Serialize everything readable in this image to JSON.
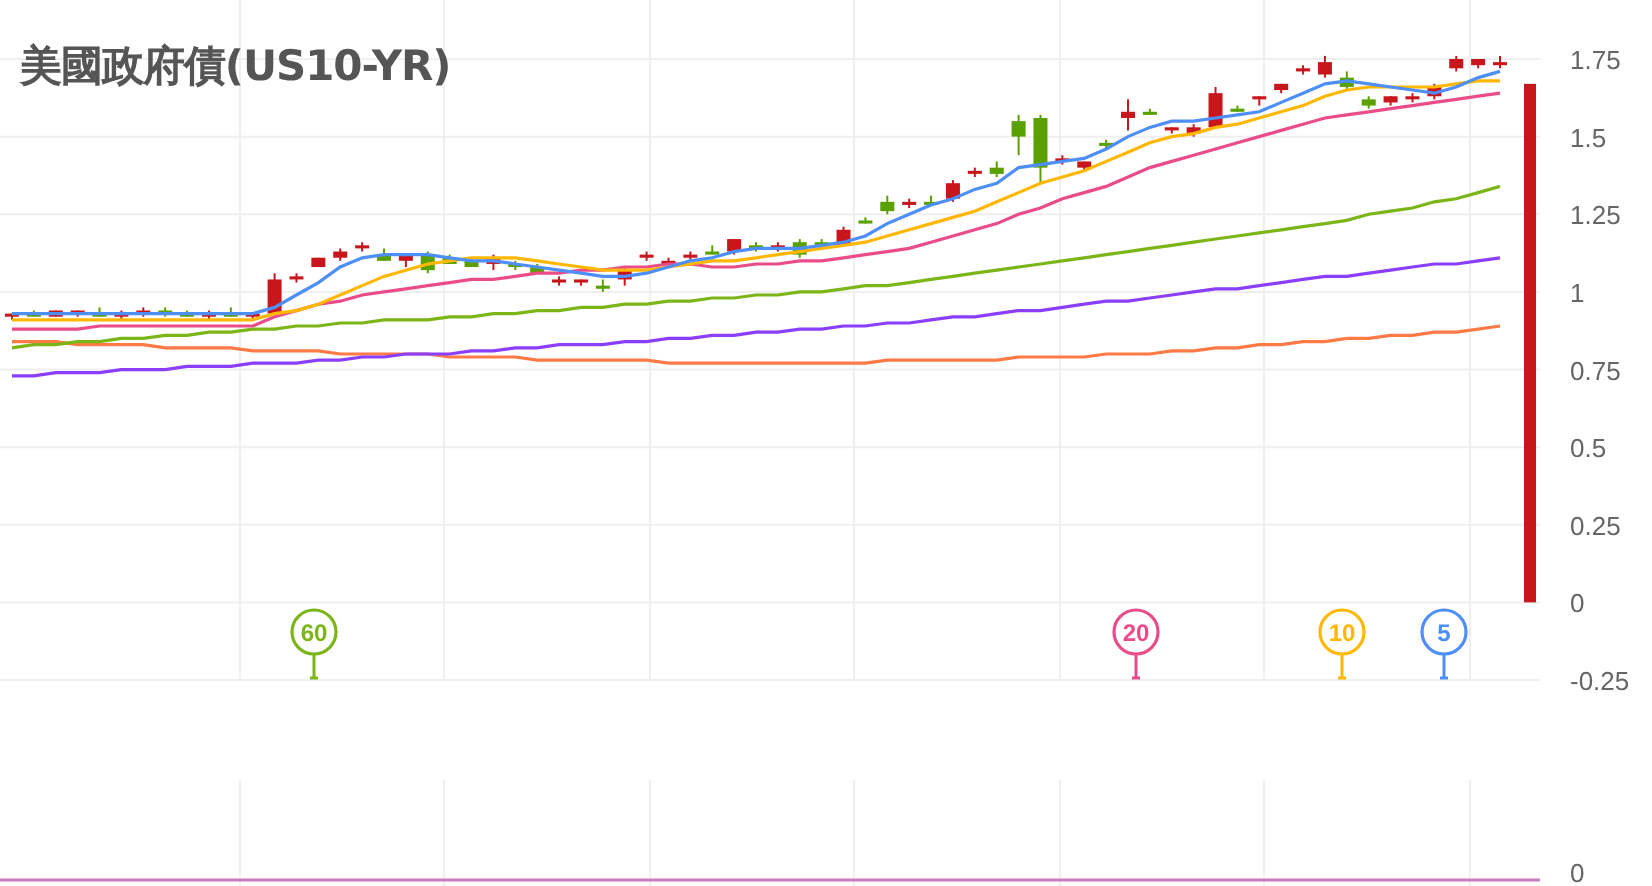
{
  "title": "美國政府債(US10-YR)",
  "chart": {
    "chart_data": {
      "type": "candlestick",
      "ylim": [
        -0.25,
        1.75
      ],
      "grid": true,
      "yticks": [
        {
          "value": 1.75,
          "label": "1.75"
        },
        {
          "value": 1.5,
          "label": "1.5"
        },
        {
          "value": 1.25,
          "label": "1.25"
        },
        {
          "value": 1,
          "label": "1"
        },
        {
          "value": 0.75,
          "label": "0.75"
        },
        {
          "value": 0.5,
          "label": "0.5"
        },
        {
          "value": 0.25,
          "label": "0.25"
        },
        {
          "value": 0,
          "label": "0"
        },
        {
          "value": -0.25,
          "label": "-0.25"
        }
      ],
      "ohlc": [
        [
          0.92,
          0.93,
          0.91,
          0.93
        ],
        [
          0.93,
          0.94,
          0.92,
          0.92
        ],
        [
          0.92,
          0.94,
          0.92,
          0.94
        ],
        [
          0.93,
          0.94,
          0.92,
          0.94
        ],
        [
          0.93,
          0.95,
          0.92,
          0.92
        ],
        [
          0.92,
          0.94,
          0.91,
          0.93
        ],
        [
          0.93,
          0.95,
          0.92,
          0.94
        ],
        [
          0.94,
          0.95,
          0.92,
          0.93
        ],
        [
          0.93,
          0.94,
          0.92,
          0.92
        ],
        [
          0.92,
          0.94,
          0.91,
          0.93
        ],
        [
          0.93,
          0.95,
          0.92,
          0.92
        ],
        [
          0.92,
          0.93,
          0.91,
          0.93
        ],
        [
          0.93,
          1.06,
          0.93,
          1.04
        ],
        [
          1.04,
          1.06,
          1.03,
          1.05
        ],
        [
          1.08,
          1.11,
          1.08,
          1.11
        ],
        [
          1.11,
          1.14,
          1.1,
          1.13
        ],
        [
          1.14,
          1.16,
          1.13,
          1.15
        ],
        [
          1.12,
          1.14,
          1.1,
          1.1
        ],
        [
          1.1,
          1.12,
          1.08,
          1.12
        ],
        [
          1.12,
          1.13,
          1.06,
          1.07
        ],
        [
          1.11,
          1.12,
          1.09,
          1.09
        ],
        [
          1.1,
          1.11,
          1.08,
          1.08
        ],
        [
          1.09,
          1.12,
          1.07,
          1.11
        ],
        [
          1.09,
          1.1,
          1.07,
          1.08
        ],
        [
          1.08,
          1.09,
          1.06,
          1.06
        ],
        [
          1.03,
          1.05,
          1.02,
          1.04
        ],
        [
          1.03,
          1.04,
          1.02,
          1.04
        ],
        [
          1.02,
          1.04,
          1.0,
          1.01
        ],
        [
          1.04,
          1.08,
          1.02,
          1.07
        ],
        [
          1.11,
          1.13,
          1.1,
          1.12
        ],
        [
          1.09,
          1.11,
          1.08,
          1.1
        ],
        [
          1.11,
          1.13,
          1.1,
          1.12
        ],
        [
          1.13,
          1.15,
          1.12,
          1.12
        ],
        [
          1.13,
          1.17,
          1.12,
          1.17
        ],
        [
          1.15,
          1.16,
          1.13,
          1.14
        ],
        [
          1.14,
          1.16,
          1.13,
          1.15
        ],
        [
          1.16,
          1.17,
          1.11,
          1.12
        ],
        [
          1.16,
          1.17,
          1.14,
          1.15
        ],
        [
          1.15,
          1.21,
          1.15,
          1.2
        ],
        [
          1.23,
          1.24,
          1.22,
          1.22
        ],
        [
          1.29,
          1.31,
          1.25,
          1.26
        ],
        [
          1.28,
          1.3,
          1.27,
          1.29
        ],
        [
          1.29,
          1.31,
          1.28,
          1.28
        ],
        [
          1.3,
          1.36,
          1.29,
          1.35
        ],
        [
          1.38,
          1.4,
          1.37,
          1.39
        ],
        [
          1.4,
          1.42,
          1.37,
          1.38
        ],
        [
          1.55,
          1.57,
          1.44,
          1.5
        ],
        [
          1.56,
          1.57,
          1.35,
          1.4
        ],
        [
          1.42,
          1.44,
          1.41,
          1.43
        ],
        [
          1.4,
          1.42,
          1.39,
          1.42
        ],
        [
          1.48,
          1.49,
          1.46,
          1.47
        ],
        [
          1.56,
          1.62,
          1.52,
          1.58
        ],
        [
          1.58,
          1.59,
          1.57,
          1.57
        ],
        [
          1.52,
          1.53,
          1.51,
          1.53
        ],
        [
          1.51,
          1.54,
          1.5,
          1.53
        ],
        [
          1.53,
          1.66,
          1.53,
          1.64
        ],
        [
          1.59,
          1.6,
          1.58,
          1.58
        ],
        [
          1.62,
          1.63,
          1.6,
          1.63
        ],
        [
          1.65,
          1.67,
          1.64,
          1.67
        ],
        [
          1.71,
          1.73,
          1.7,
          1.72
        ],
        [
          1.7,
          1.76,
          1.69,
          1.74
        ],
        [
          1.69,
          1.71,
          1.65,
          1.66
        ],
        [
          1.62,
          1.63,
          1.59,
          1.6
        ],
        [
          1.61,
          1.63,
          1.6,
          1.63
        ],
        [
          1.62,
          1.64,
          1.61,
          1.63
        ],
        [
          1.63,
          1.67,
          1.62,
          1.66
        ],
        [
          1.72,
          1.76,
          1.71,
          1.75
        ],
        [
          1.73,
          1.75,
          1.72,
          1.75
        ],
        [
          1.73,
          1.76,
          1.72,
          1.74
        ]
      ]
    }
  },
  "moving_averages": {
    "chart_data": {
      "type": "line",
      "ylim": [
        -0.25,
        1.75
      ],
      "series": [
        {
          "name": "5",
          "color": "#4e8ef7",
          "values": [
            0.93,
            0.93,
            0.93,
            0.93,
            0.93,
            0.93,
            0.93,
            0.93,
            0.93,
            0.93,
            0.93,
            0.93,
            0.95,
            0.99,
            1.03,
            1.08,
            1.11,
            1.12,
            1.12,
            1.12,
            1.11,
            1.1,
            1.1,
            1.09,
            1.08,
            1.07,
            1.06,
            1.05,
            1.05,
            1.06,
            1.08,
            1.1,
            1.11,
            1.13,
            1.14,
            1.14,
            1.14,
            1.15,
            1.16,
            1.18,
            1.22,
            1.25,
            1.28,
            1.3,
            1.33,
            1.35,
            1.4,
            1.41,
            1.42,
            1.43,
            1.46,
            1.5,
            1.53,
            1.55,
            1.55,
            1.56,
            1.57,
            1.58,
            1.61,
            1.64,
            1.67,
            1.68,
            1.67,
            1.66,
            1.65,
            1.64,
            1.66,
            1.69,
            1.71
          ]
        },
        {
          "name": "10",
          "color": "#ffb703",
          "values": [
            0.91,
            0.91,
            0.91,
            0.91,
            0.91,
            0.91,
            0.91,
            0.91,
            0.91,
            0.91,
            0.91,
            0.91,
            0.93,
            0.94,
            0.96,
            0.99,
            1.02,
            1.05,
            1.07,
            1.09,
            1.1,
            1.11,
            1.11,
            1.11,
            1.1,
            1.09,
            1.08,
            1.07,
            1.07,
            1.07,
            1.08,
            1.09,
            1.1,
            1.1,
            1.11,
            1.12,
            1.13,
            1.14,
            1.15,
            1.16,
            1.18,
            1.2,
            1.22,
            1.24,
            1.26,
            1.29,
            1.32,
            1.35,
            1.37,
            1.39,
            1.42,
            1.45,
            1.48,
            1.5,
            1.51,
            1.53,
            1.54,
            1.56,
            1.58,
            1.6,
            1.63,
            1.65,
            1.66,
            1.66,
            1.66,
            1.66,
            1.67,
            1.68,
            1.68
          ]
        },
        {
          "name": "20",
          "color": "#ea4c89",
          "values": [
            0.88,
            0.88,
            0.88,
            0.88,
            0.89,
            0.89,
            0.89,
            0.89,
            0.89,
            0.89,
            0.89,
            0.89,
            0.92,
            0.94,
            0.96,
            0.97,
            0.99,
            1.0,
            1.01,
            1.02,
            1.03,
            1.04,
            1.04,
            1.05,
            1.06,
            1.06,
            1.07,
            1.07,
            1.08,
            1.08,
            1.09,
            1.09,
            1.08,
            1.08,
            1.09,
            1.09,
            1.1,
            1.1,
            1.11,
            1.12,
            1.13,
            1.14,
            1.16,
            1.18,
            1.2,
            1.22,
            1.25,
            1.27,
            1.3,
            1.32,
            1.34,
            1.37,
            1.4,
            1.42,
            1.44,
            1.46,
            1.48,
            1.5,
            1.52,
            1.54,
            1.56,
            1.57,
            1.58,
            1.59,
            1.6,
            1.61,
            1.62,
            1.63,
            1.64
          ]
        },
        {
          "name": "60",
          "color": "#7cb518",
          "values": [
            0.82,
            0.83,
            0.83,
            0.84,
            0.84,
            0.85,
            0.85,
            0.86,
            0.86,
            0.87,
            0.87,
            0.88,
            0.88,
            0.89,
            0.89,
            0.9,
            0.9,
            0.91,
            0.91,
            0.91,
            0.92,
            0.92,
            0.93,
            0.93,
            0.94,
            0.94,
            0.95,
            0.95,
            0.96,
            0.96,
            0.97,
            0.97,
            0.98,
            0.98,
            0.99,
            0.99,
            1.0,
            1.0,
            1.01,
            1.02,
            1.02,
            1.03,
            1.04,
            1.05,
            1.06,
            1.07,
            1.08,
            1.09,
            1.1,
            1.11,
            1.12,
            1.13,
            1.14,
            1.15,
            1.16,
            1.17,
            1.18,
            1.19,
            1.2,
            1.21,
            1.22,
            1.23,
            1.25,
            1.26,
            1.27,
            1.29,
            1.3,
            1.32,
            1.34
          ]
        },
        {
          "color": "#8a3ffc",
          "values": [
            0.73,
            0.73,
            0.74,
            0.74,
            0.74,
            0.75,
            0.75,
            0.75,
            0.76,
            0.76,
            0.76,
            0.77,
            0.77,
            0.77,
            0.78,
            0.78,
            0.79,
            0.79,
            0.8,
            0.8,
            0.8,
            0.81,
            0.81,
            0.82,
            0.82,
            0.83,
            0.83,
            0.83,
            0.84,
            0.84,
            0.85,
            0.85,
            0.86,
            0.86,
            0.87,
            0.87,
            0.88,
            0.88,
            0.89,
            0.89,
            0.9,
            0.9,
            0.91,
            0.92,
            0.92,
            0.93,
            0.94,
            0.94,
            0.95,
            0.96,
            0.97,
            0.97,
            0.98,
            0.99,
            1.0,
            1.01,
            1.01,
            1.02,
            1.03,
            1.04,
            1.05,
            1.05,
            1.06,
            1.07,
            1.08,
            1.09,
            1.09,
            1.1,
            1.11
          ]
        },
        {
          "color": "#ff7a45",
          "values": [
            0.84,
            0.84,
            0.84,
            0.83,
            0.83,
            0.83,
            0.83,
            0.82,
            0.82,
            0.82,
            0.82,
            0.81,
            0.81,
            0.81,
            0.81,
            0.8,
            0.8,
            0.8,
            0.8,
            0.8,
            0.79,
            0.79,
            0.79,
            0.79,
            0.78,
            0.78,
            0.78,
            0.78,
            0.78,
            0.78,
            0.77,
            0.77,
            0.77,
            0.77,
            0.77,
            0.77,
            0.77,
            0.77,
            0.77,
            0.77,
            0.78,
            0.78,
            0.78,
            0.78,
            0.78,
            0.78,
            0.79,
            0.79,
            0.79,
            0.79,
            0.8,
            0.8,
            0.8,
            0.81,
            0.81,
            0.82,
            0.82,
            0.83,
            0.83,
            0.84,
            0.84,
            0.85,
            0.85,
            0.86,
            0.86,
            0.87,
            0.87,
            0.88,
            0.89
          ]
        }
      ]
    }
  },
  "lower_panel": {
    "y_label": "0"
  }
}
